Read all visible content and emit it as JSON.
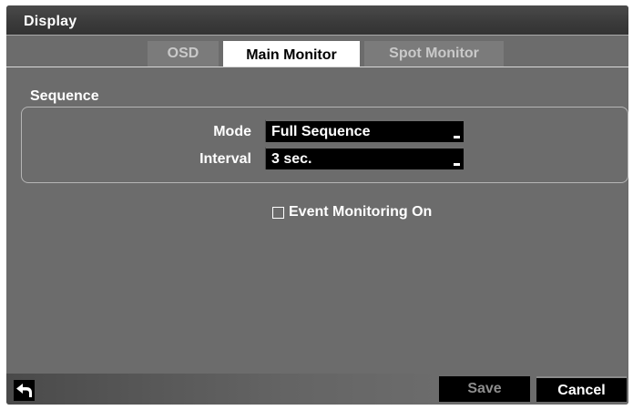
{
  "window": {
    "title": "Display"
  },
  "tabs": [
    {
      "label": "OSD",
      "active": false
    },
    {
      "label": "Main Monitor",
      "active": true
    },
    {
      "label": "Spot Monitor",
      "active": false
    }
  ],
  "sequence": {
    "title": "Sequence",
    "mode": {
      "label": "Mode",
      "value": "Full Sequence"
    },
    "interval": {
      "label": "Interval",
      "value": "3 sec."
    }
  },
  "event_monitoring": {
    "label": "Event Monitoring On",
    "checked": false
  },
  "footer": {
    "back_icon": "back-arrow-icon",
    "save_label": "Save",
    "cancel_label": "Cancel"
  },
  "colors": {
    "background": "#6c6c6c",
    "titlebar": "#3a3a3a",
    "dropdown": "#000000",
    "active_tab": "#ffffff"
  }
}
